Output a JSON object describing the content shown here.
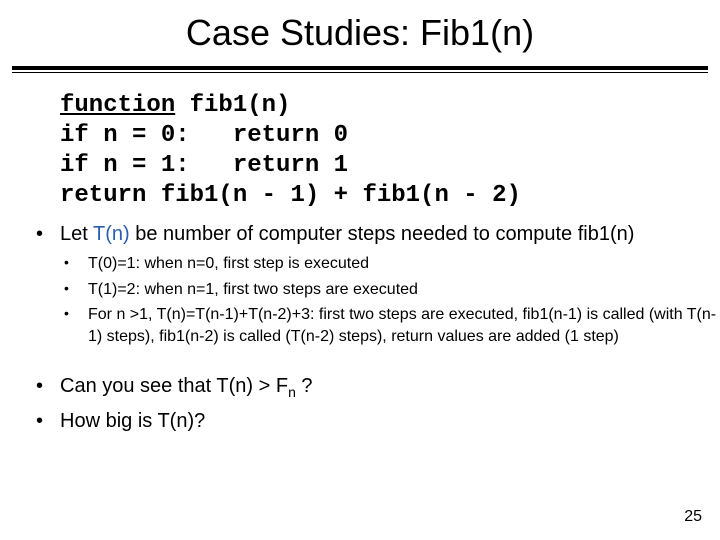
{
  "title": "Case Studies: Fib1(n)",
  "code": {
    "l1a": "function",
    "l1b": " fib1(n)",
    "l2": "if n = 0:   return 0",
    "l3": "if n = 1:   return 1",
    "l4": "return fib1(n - 1) + fib1(n - 2)"
  },
  "main": {
    "let_pre": "Let ",
    "tn": "T(n)",
    "let_post": " be number of computer steps needed to compute fib1(n)"
  },
  "subs": {
    "s1": "T(0)=1: when n=0, first step is executed",
    "s2": "T(1)=2: when n=1, first two steps are executed",
    "s3": "For n >1,  T(n)=T(n-1)+T(n-2)+3: first two steps are executed, fib1(n-1) is called (with T(n-1) steps), fib1(n-2) is called (T(n-2) steps), return values are added (1 step)"
  },
  "q1_pre": "Can you see that T(n) > F",
  "q1_sub": "n",
  "q1_post": " ?",
  "q2": "How big is T(n)?",
  "page": "25"
}
